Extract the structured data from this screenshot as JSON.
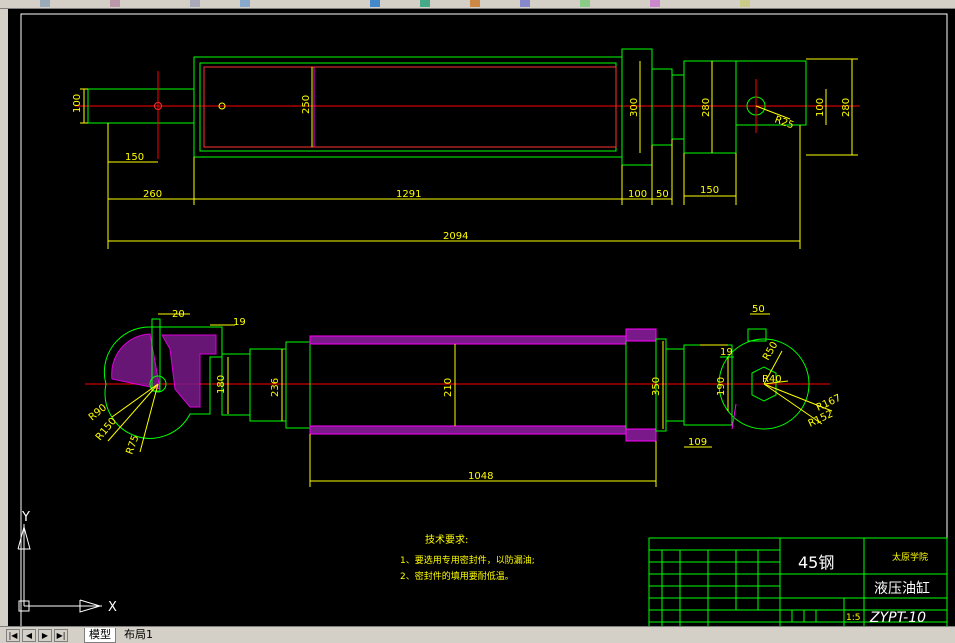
{
  "drawing": {
    "top_view": {
      "dims": {
        "d100_left": "100",
        "d250": "250",
        "d300": "300",
        "d280": "280",
        "d100_right": "100",
        "d280_right": "280",
        "d150": "150",
        "d260": "260",
        "d1291": "1291",
        "d100_bot": "100",
        "d50_bot": "50",
        "d150_right": "150",
        "d2094": "2094",
        "r25": "R25"
      }
    },
    "section_view": {
      "dims": {
        "d20": "20",
        "d19_left": "19",
        "d180": "180",
        "d236": "236",
        "d210": "210",
        "d350": "350",
        "d19_right": "19",
        "d190": "190",
        "d50": "50",
        "d109": "109",
        "d1048": "1048",
        "r90": "R90",
        "r150": "R150",
        "r75": "R75",
        "r50": "R50",
        "r40": "R40",
        "r167": "R167",
        "r152": "R152"
      }
    },
    "notes": {
      "title": "技术要求:",
      "line1": "1、要选用专用密封件，以防漏油;",
      "line2": "2、密封件的填用要耐低温。"
    },
    "title_block": {
      "material": "45钢",
      "school": "太原学院",
      "part_name": "液压油缸",
      "drawing_no": "ZYPT-10",
      "scale": "1:5"
    },
    "ucs": {
      "x": "X",
      "y": "Y"
    }
  },
  "tabs": {
    "model": "模型",
    "layout1": "布局1"
  },
  "colors": {
    "background": "#000000",
    "outline": "#00ff00",
    "dimension": "#ffff00",
    "centerline": "#ff0000",
    "hatch": "#ff00ff",
    "table_text": "#ffffff"
  }
}
